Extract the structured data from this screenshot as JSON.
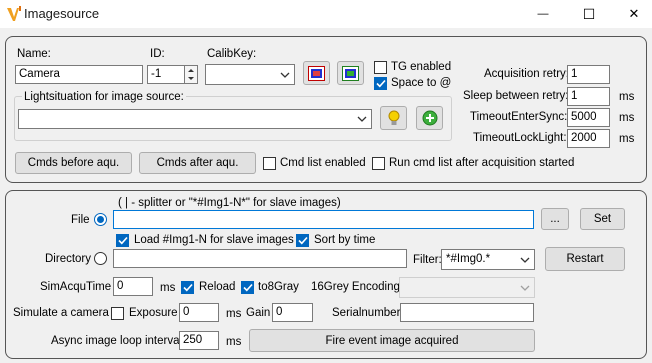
{
  "window": {
    "title": "Imagesource",
    "minimize_glyph": "—",
    "maximize_glyph": "☐",
    "close_glyph": "✕"
  },
  "camera": {
    "name_label": "Name:",
    "name_value": "Camera",
    "id_label": "ID:",
    "id_value": "-1",
    "calib_label": "CalibKey:",
    "calib_value": "",
    "tg_enabled_label": "TG enabled",
    "tg_enabled": false,
    "space_to_label": "Space to @",
    "space_to": true,
    "lightsituation_label": "Lightsituation for image source:",
    "lightsituation_value": "",
    "cmds_before_label": "Cmds before aqu.",
    "cmds_after_label": "Cmds after aqu.",
    "cmd_list_enabled_label": "Cmd list enabled",
    "cmd_list_enabled": false,
    "run_cmd_list_label": "Run cmd list after acquisition started",
    "run_cmd_list": false,
    "acquisition_retry_label": "Acquisition retry:",
    "acquisition_retry_value": "1",
    "sleep_retry_label": "Sleep between retry:",
    "sleep_retry_value": "1",
    "sleep_retry_unit": "ms",
    "timeout_sync_label": "TimeoutEnterSync:",
    "timeout_sync_value": "5000",
    "timeout_sync_unit": "ms",
    "timeout_light_label": "TimeoutLockLight:",
    "timeout_light_value": "2000",
    "timeout_light_unit": "ms"
  },
  "source": {
    "hint": "( | - splitter or \"*#Img1-N*\" for slave images)",
    "file_label": "File",
    "file_selected": true,
    "file_value": "",
    "browse_label": "...",
    "set_label": "Set",
    "load_img_label": "Load #Img1-N for slave images",
    "load_img": true,
    "sort_time_label": "Sort by time",
    "sort_time": true,
    "directory_label": "Directory",
    "directory_selected": false,
    "directory_value": "",
    "filter_label": "Filter:",
    "filter_value": "*#Img0.*",
    "restart_label": "Restart",
    "simacqu_label": "SimAcquTime",
    "simacqu_value": "0",
    "simacqu_unit": "ms",
    "reload_label": "Reload",
    "reload": true,
    "to8gray_label": "to8Gray",
    "to8gray": true,
    "grey16_label": "16Grey Encoding",
    "grey16_value": "",
    "simulate_label": "Simulate a camera",
    "exposure_label": "Exposure",
    "exposure": false,
    "exposure_value": "0",
    "exposure_unit": "ms",
    "gain_label": "Gain",
    "gain_value": "0",
    "serial_label": "Serialnumber",
    "serial_value": "",
    "async_label": "Async image loop interval",
    "async_value": "250",
    "async_unit": "ms",
    "fire_label": "Fire event image acquired"
  },
  "colors": {
    "accent": "#0067c0",
    "focus_border": "#0078d7",
    "logo": "#f0a020"
  }
}
